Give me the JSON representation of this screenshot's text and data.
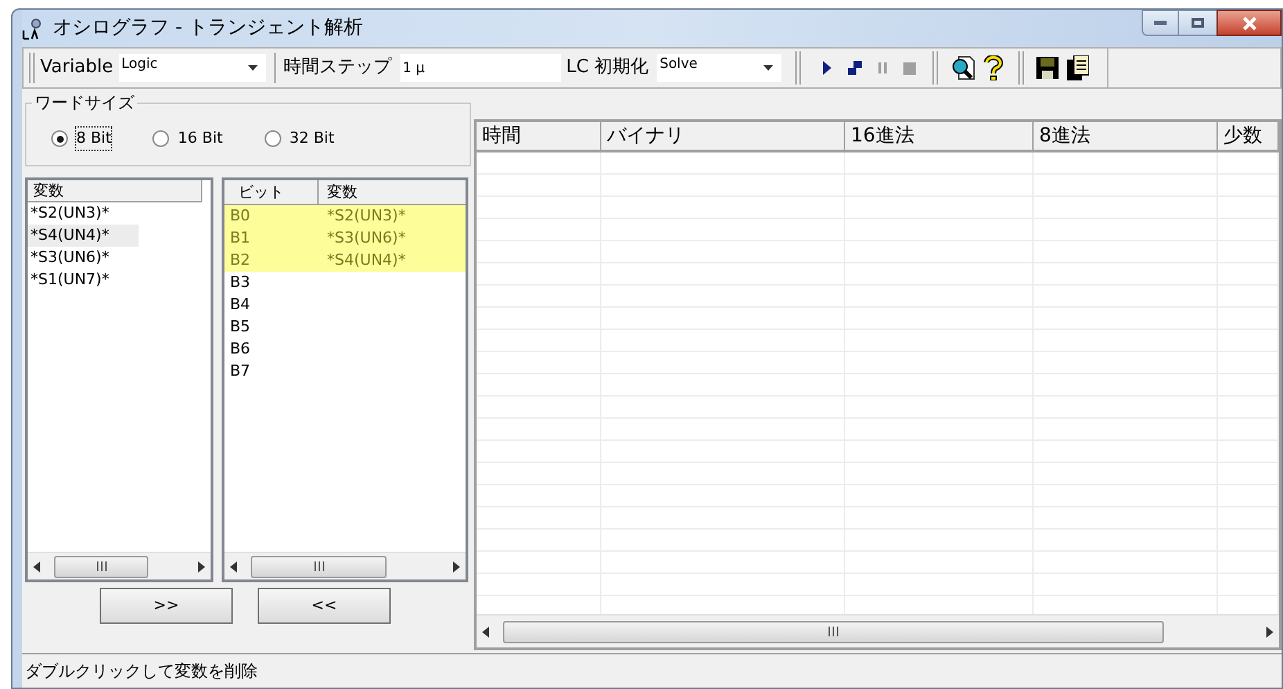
{
  "window": {
    "title": "オシログラフ - トランジェント解析"
  },
  "toolbar": {
    "variable_label": "Variable",
    "variable_combo": "Logic",
    "time_step_label": "時間ステップ",
    "time_step": "1 μ",
    "lc_init_label": "LC 初期化",
    "lc_init_combo": "Solve"
  },
  "word_size": {
    "title": "ワードサイズ",
    "options": [
      {
        "label": "8 Bit",
        "selected": true
      },
      {
        "label": "16 Bit",
        "selected": false
      },
      {
        "label": "32 Bit",
        "selected": false
      }
    ]
  },
  "variable_list": {
    "header": "変数",
    "items": [
      {
        "label": "*S2(UN3)*",
        "selected": false
      },
      {
        "label": "*S4(UN4)*",
        "selected": true
      },
      {
        "label": "*S3(UN6)*",
        "selected": false
      },
      {
        "label": "*S1(UN7)*",
        "selected": false
      }
    ]
  },
  "bit_list": {
    "columns": [
      "ビット",
      "変数"
    ],
    "rows": [
      {
        "bit": "B0",
        "variable": "*S2(UN3)*",
        "selected": true
      },
      {
        "bit": "B1",
        "variable": "*S3(UN6)*",
        "selected": true
      },
      {
        "bit": "B2",
        "variable": "*S4(UN4)*",
        "selected": true
      },
      {
        "bit": "B3",
        "selected": false
      },
      {
        "bit": "B4",
        "selected": false
      },
      {
        "bit": "B5",
        "selected": false
      },
      {
        "bit": "B6",
        "selected": false
      },
      {
        "bit": "B7",
        "selected": false
      }
    ]
  },
  "buttons": [
    ">>",
    "<<"
  ],
  "table": {
    "columns": [
      "時間",
      "バイナリ",
      "16進法",
      "8進法",
      "少数"
    ]
  },
  "status_bar": "ダブルクリックして変数を削除"
}
